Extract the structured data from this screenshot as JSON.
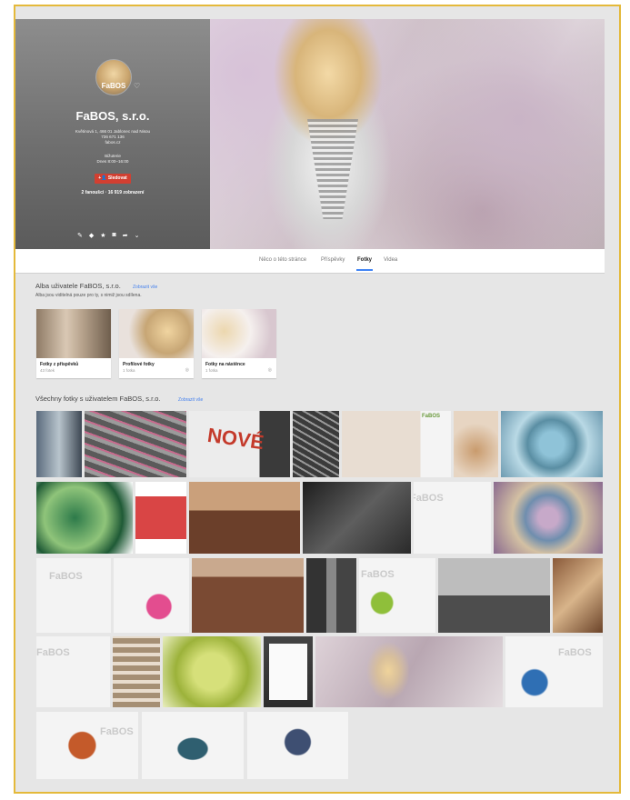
{
  "profile": {
    "avatar_label": "FaBOS",
    "name": "FaBOS, s.r.o.",
    "address": "Květinová 1, 466 01 Jablonec nad Nisou",
    "phone": "736 671 136",
    "website": "fabos.cz",
    "status": "Bižuterie",
    "hours": "Dnes 8:00–16:00",
    "follow_label": "Sledovat",
    "stats": "2 fanoušci · 16 919 zobrazení"
  },
  "tabs": [
    {
      "label": "Něco o této stránce"
    },
    {
      "label": "Příspěvky"
    },
    {
      "label": "Fotky"
    },
    {
      "label": "Videa"
    }
  ],
  "albums_section": {
    "title": "Alba uživatele FaBOS, s.r.o.",
    "link": "Zobrazit vše",
    "subtitle": "Alba jsou viditelná pouze pro ty, s nimiž jsou sdílena.",
    "albums": [
      {
        "title": "Fotky z příspěvků",
        "count": "43 fotek"
      },
      {
        "title": "Profilové fotky",
        "count": "1 fotka"
      },
      {
        "title": "Fotky na nástěnce",
        "count": "1 fotka"
      }
    ]
  },
  "photos_section": {
    "title": "Všechny fotky s uživatelem FaBOS, s.r.o.",
    "link": "Zobrazit vše"
  },
  "watermark": "FaBOS",
  "sign_text": "NOVÉ",
  "colors": {
    "follow": "#d23f31",
    "link": "#427fed",
    "frame": "#e4b93a",
    "accent_tab": "#4285f4"
  }
}
